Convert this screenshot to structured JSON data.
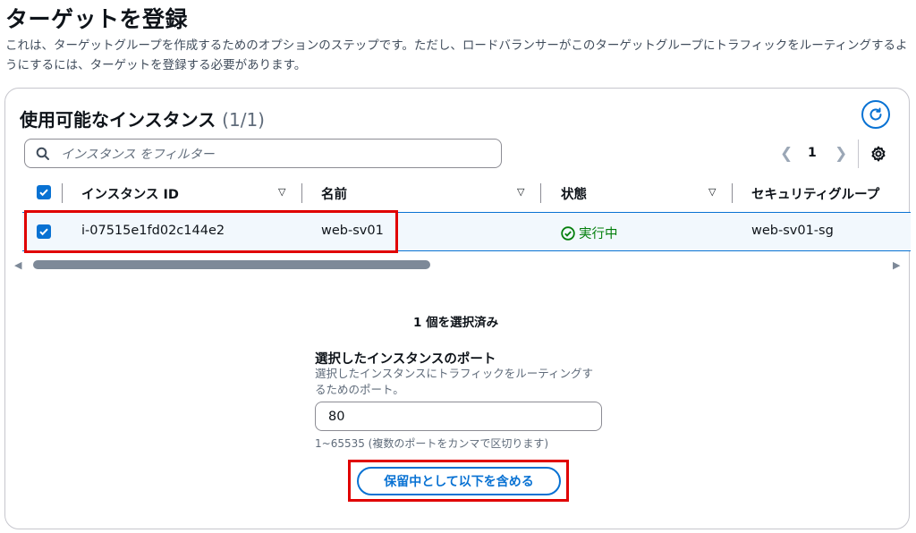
{
  "page": {
    "title": "ターゲットを登録",
    "description": "これは、ターゲットグループを作成するためのオプションのステップです。ただし、ロードバランサーがこのターゲットグループにトラフィックをルーティングするようにするには、ターゲットを登録する必要があります。"
  },
  "instances_panel": {
    "title": "使用可能なインスタンス",
    "count": "(1/1)",
    "search_placeholder": "インスタンス をフィルター",
    "page_number": "1",
    "columns": [
      "インスタンス ID",
      "名前",
      "状態",
      "セキュリティグループ"
    ],
    "rows": [
      {
        "instance_id": "i-07515e1fd02c144e2",
        "name": "web-sv01",
        "state": "実行中",
        "security_group": "web-sv01-sg",
        "selected": true
      }
    ]
  },
  "selection": {
    "count_text": "1 個を選択済み",
    "port_label": "選択したインスタンスのポート",
    "port_help": "選択したインスタンスにトラフィックをルーティングするためのポート。",
    "port_value": "80",
    "port_range": "1~65535 (複数のポートをカンマで区切ります)",
    "include_button": "保留中として以下を含める"
  },
  "colors": {
    "accent": "#0972d3",
    "success": "#037f0c",
    "highlight": "#e00000",
    "row_selected_bg": "#f2f8fd"
  },
  "icons": [
    "search-icon",
    "refresh-icon",
    "chevron-left-icon",
    "chevron-right-icon",
    "gear-icon",
    "sort-down-icon",
    "checkbox-checked-icon",
    "status-check-icon",
    "scroll-left-icon",
    "scroll-right-icon"
  ]
}
